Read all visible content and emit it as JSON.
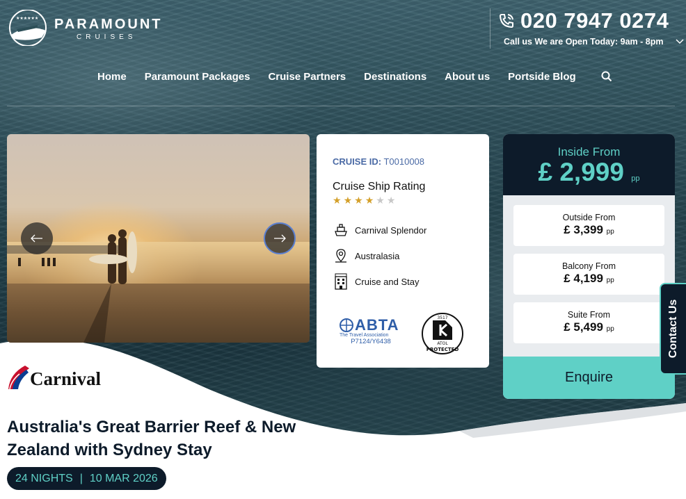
{
  "brand": {
    "name": "PARAMOUNT",
    "sub": "CRUISES"
  },
  "contact": {
    "phone": "020 7947 0274",
    "open_text": "Call us We are Open Today: 9am - 8pm"
  },
  "nav": {
    "items": [
      "Home",
      "Paramount Packages",
      "Cruise Partners",
      "Destinations",
      "About us",
      "Portside Blog"
    ]
  },
  "cruise": {
    "id_label": "CRUISE ID:",
    "id_value": "T0010008",
    "rating_title": "Cruise Ship Rating",
    "rating": 4,
    "rating_max": 6,
    "ship": "Carnival Splendor",
    "region": "Australasia",
    "type": "Cruise and Stay",
    "line": "Carnival",
    "title": "Australia's Great Barrier Reef & New Zealand with Sydney Stay",
    "nights": "24 NIGHTS",
    "separator": "|",
    "date": "10 MAR 2026"
  },
  "accreditation": {
    "abta_name": "ABTA",
    "abta_sub": "The Travel Association",
    "abta_code": "P7124/Y6438",
    "atol_number": "3517",
    "atol_text": "ATOL",
    "atol_protected": "PROTECTED"
  },
  "prices": {
    "inside_label": "Inside From",
    "inside_value": "£ 2,999",
    "pp": "pp",
    "options": [
      {
        "label": "Outside From",
        "value": "£ 3,399"
      },
      {
        "label": "Balcony From",
        "value": "£ 4,199"
      },
      {
        "label": "Suite From",
        "value": "£ 5,499"
      }
    ],
    "enquire": "Enquire"
  },
  "contact_tab": "Contact Us",
  "colors": {
    "navy": "#0d1b2a",
    "teal": "#5fd0c6",
    "abta_blue": "#2f5ea8",
    "star_gold": "#d4a02a"
  }
}
